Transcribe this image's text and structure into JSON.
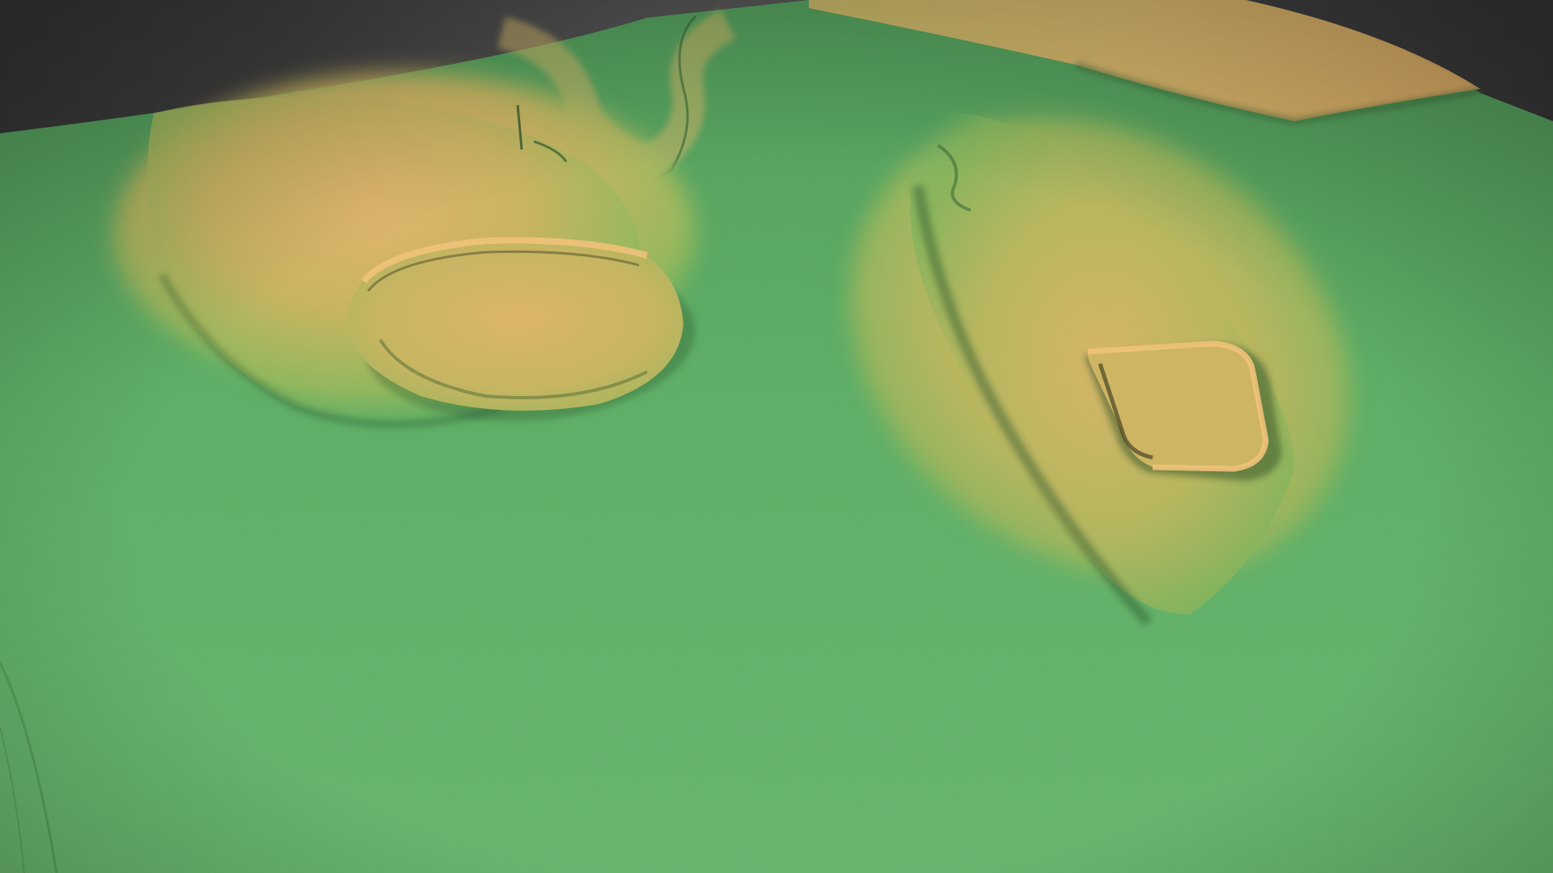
{
  "scene": {
    "subject": "lidar-terrain-elevation-model",
    "colors": {
      "background": "#3e3e3e",
      "lowland": "#63b86b",
      "lowland_dark": "#4f9f59",
      "mid_slope": "#a9bf5c",
      "highland": "#d9b268",
      "ridge_highlight": "#f0c27a",
      "shadow": "#2f5a2f"
    },
    "icons": []
  }
}
